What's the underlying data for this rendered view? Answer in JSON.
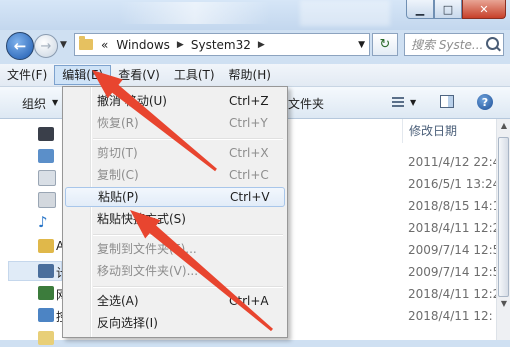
{
  "window": {
    "caption_buttons": [
      "minimize",
      "maximize",
      "close"
    ]
  },
  "address": {
    "overflow": "«",
    "crumbs": [
      "Windows",
      "System32"
    ],
    "search_placeholder": "搜索 Syste..."
  },
  "menubar": {
    "items": [
      "文件(F)",
      "编辑(E)",
      "查看(V)",
      "工具(T)",
      "帮助(H)"
    ],
    "open_item": "编辑(E)"
  },
  "toolbar": {
    "organize": "组织",
    "new_folder": "文件夹"
  },
  "nav_pane": {
    "labels": [
      "A",
      "计",
      "网",
      "控"
    ]
  },
  "content": {
    "date_column": "修改日期",
    "dates": [
      "2011/4/12 22:4",
      "2016/5/1 13:24",
      "2018/8/15 14:1",
      "2018/4/11 12:2",
      "2009/7/14 12:5",
      "2009/7/14 12:5",
      "2018/4/11 12:2",
      "2018/4/11 12:"
    ]
  },
  "edit_menu": {
    "items": [
      {
        "label": "撤消 移动(U)",
        "shortcut": "Ctrl+Z",
        "enabled": true
      },
      {
        "label": "恢复(R)",
        "shortcut": "Ctrl+Y",
        "enabled": false
      },
      {
        "label": "剪切(T)",
        "shortcut": "Ctrl+X",
        "enabled": false
      },
      {
        "label": "复制(C)",
        "shortcut": "Ctrl+C",
        "enabled": false
      },
      {
        "label": "粘贴(P)",
        "shortcut": "Ctrl+V",
        "enabled": true,
        "highlighted": true
      },
      {
        "label": "粘贴快捷方式(S)",
        "shortcut": "",
        "enabled": true
      },
      {
        "label": "复制到文件夹(F)...",
        "shortcut": "",
        "enabled": false
      },
      {
        "label": "移动到文件夹(V)...",
        "shortcut": "",
        "enabled": false
      },
      {
        "label": "全选(A)",
        "shortcut": "Ctrl+A",
        "enabled": true
      },
      {
        "label": "反向选择(I)",
        "shortcut": "",
        "enabled": true
      }
    ]
  },
  "annotation": {
    "arrow_color": "#e8452f"
  }
}
